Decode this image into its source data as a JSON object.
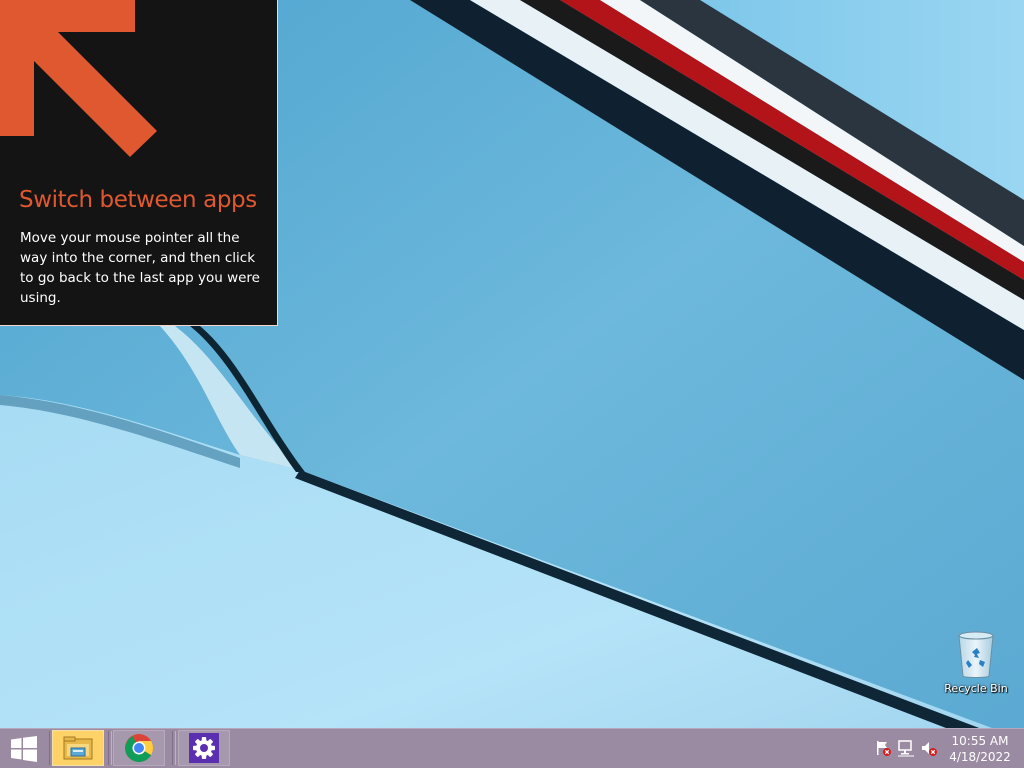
{
  "tip": {
    "title": "Switch between apps",
    "body": "Move your mouse pointer all the way into the corner, and then click to go back to the last app you were using.",
    "accent_color": "#e0582f",
    "icon": "arrow-up-left-icon"
  },
  "desktop": {
    "icons": [
      {
        "label": "Recycle Bin",
        "icon": "recycle-bin-icon"
      }
    ]
  },
  "taskbar": {
    "start_icon": "windows-logo-icon",
    "apps": [
      {
        "name": "File Explorer",
        "icon": "file-explorer-icon",
        "active": true
      },
      {
        "name": "Google Chrome",
        "icon": "chrome-icon",
        "active": false
      },
      {
        "name": "Settings",
        "icon": "settings-gear-icon",
        "active": false
      }
    ],
    "tray": {
      "icons": [
        "action-center-flag-icon",
        "network-icon",
        "volume-muted-icon"
      ]
    },
    "clock": {
      "time": "10:55 AM",
      "date": "4/18/2022"
    },
    "color": "#9b8ba2"
  }
}
